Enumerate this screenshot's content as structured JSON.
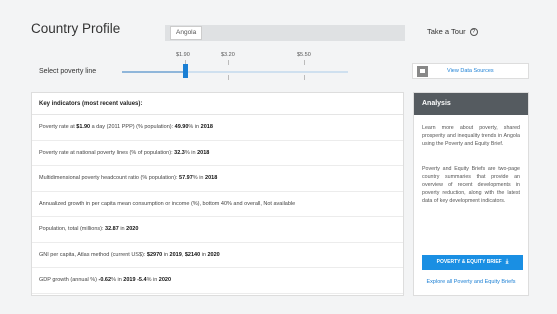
{
  "page": {
    "title": "Country Profile"
  },
  "country_select": {
    "value": "Angola"
  },
  "tour": {
    "label": "Take a Tour",
    "icon": "help-circle-icon"
  },
  "poverty_line": {
    "label": "Select poverty line",
    "ticks": [
      "$1.90",
      "$3.20",
      "$5.50"
    ],
    "selected": "$1.90"
  },
  "indicators": {
    "heading": "Key indicators (most recent values):",
    "rows": [
      [
        {
          "t": "Poverty rate at "
        },
        {
          "t": "$1.90",
          "b": true
        },
        {
          "t": " a day (2011 PPP) (% population): "
        },
        {
          "t": "49.90",
          "b": true
        },
        {
          "t": "% in "
        },
        {
          "t": "2018",
          "b": true
        }
      ],
      [
        {
          "t": "Poverty rate at national poverty lines (% of population): "
        },
        {
          "t": "32.3",
          "b": true
        },
        {
          "t": "% in "
        },
        {
          "t": "2018",
          "b": true
        }
      ],
      [
        {
          "t": "Multidimensional poverty headcount ratio (% population): "
        },
        {
          "t": "57.97",
          "b": true
        },
        {
          "t": "% in "
        },
        {
          "t": "2018",
          "b": true
        }
      ],
      [
        {
          "t": "Annualized growth in per capita mean consumption or income (%), bottom 40% and overall, Not available"
        }
      ],
      [
        {
          "t": "Population, total (millions): "
        },
        {
          "t": "32.87",
          "b": true
        },
        {
          "t": " in "
        },
        {
          "t": "2020",
          "b": true
        }
      ],
      [
        {
          "t": "GNI per capita, Atlas method (current US$): "
        },
        {
          "t": "$2970",
          "b": true
        },
        {
          "t": " in "
        },
        {
          "t": "2019",
          "b": true
        },
        {
          "t": ", "
        },
        {
          "t": "$2140",
          "b": true
        },
        {
          "t": " in "
        },
        {
          "t": "2020",
          "b": true
        }
      ],
      [
        {
          "t": "GDP growth (annual %) "
        },
        {
          "t": "-0.62",
          "b": true
        },
        {
          "t": "% in "
        },
        {
          "t": "2019",
          "b": true
        },
        {
          "t": " "
        },
        {
          "t": "-5.4",
          "b": true
        },
        {
          "t": "% in "
        },
        {
          "t": "2020",
          "b": true
        }
      ]
    ]
  },
  "data_sources": {
    "label": "View Data Sources",
    "icon": "data-sources-icon"
  },
  "analysis": {
    "title": "Analysis",
    "paragraph1": "Learn more about poverty, shared prosperity and inequality trends in Angola using the Poverty and Equity Brief.",
    "paragraph2": "Poverty and Equity Briefs are two-page country summaries that provide an overview of recent developments in poverty reduction, along with the latest data of key development indicators.",
    "button_label": "POVERTY & EQUITY BRIEF",
    "button_icon": "download-icon",
    "explore_link": "Explore all Poverty and Equity Briefs"
  },
  "colors": {
    "accent": "#1a8fe3",
    "header_dark": "#555b60",
    "link": "#1a7fd4"
  }
}
